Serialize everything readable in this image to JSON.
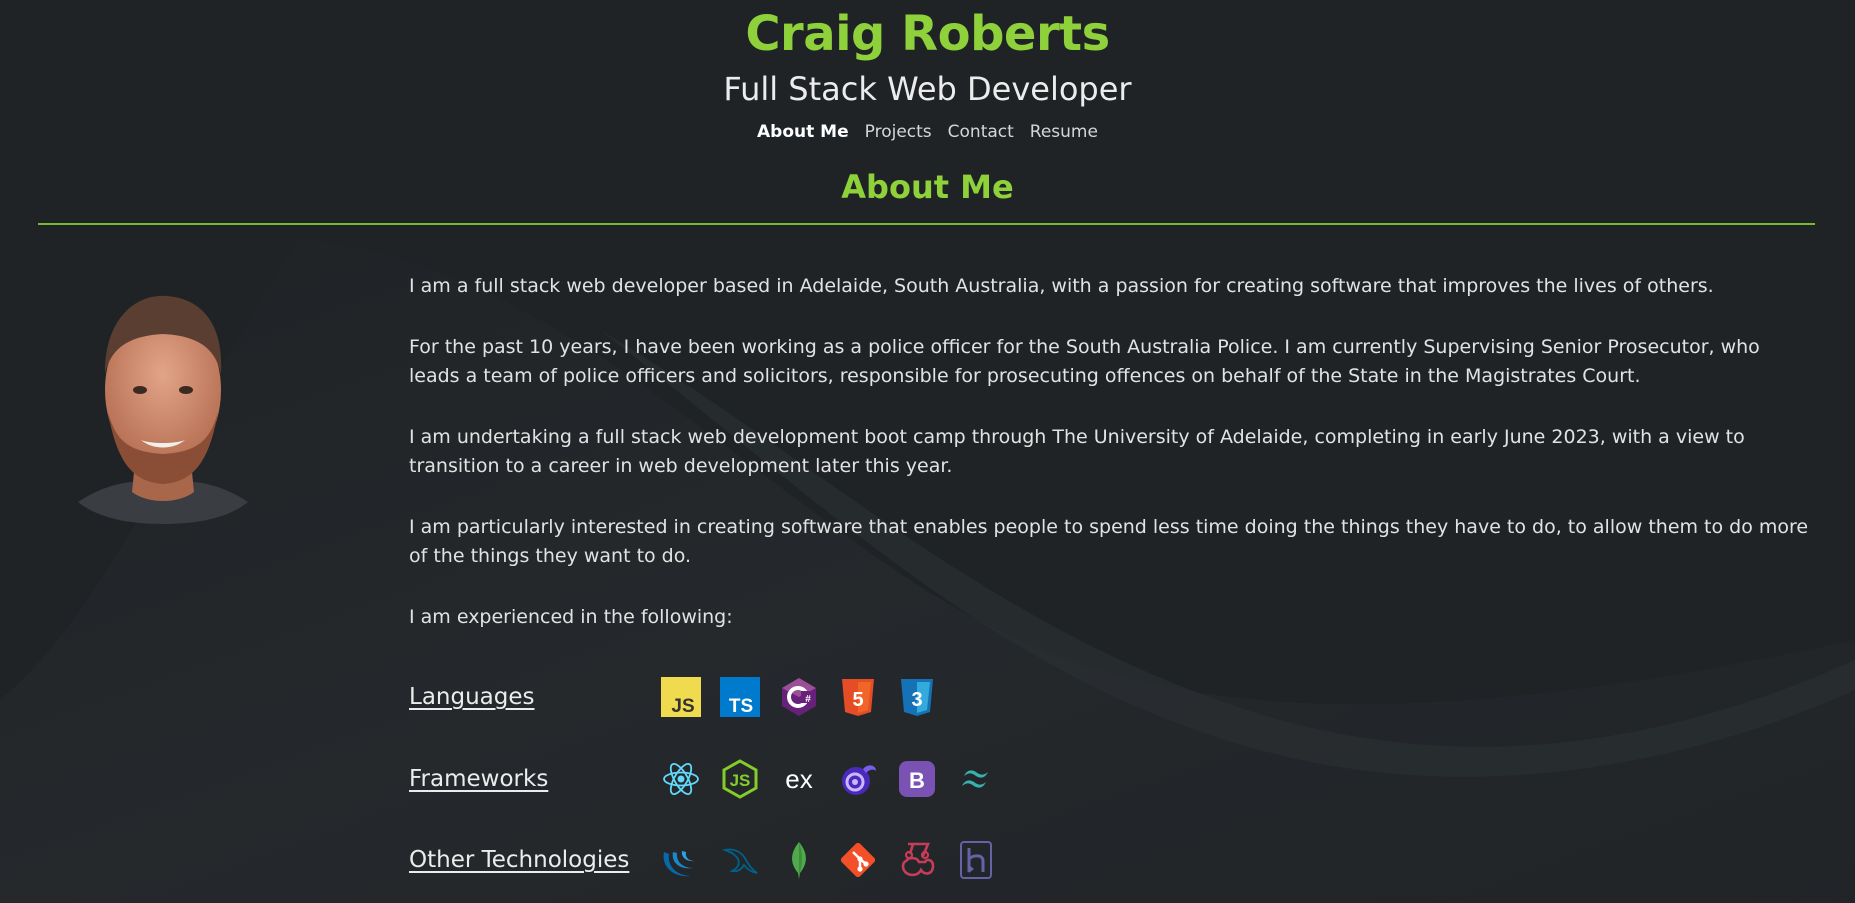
{
  "header": {
    "name": "Craig Roberts",
    "role": "Full Stack Web Developer"
  },
  "nav": {
    "items": [
      {
        "label": "About Me",
        "active": true
      },
      {
        "label": "Projects",
        "active": false
      },
      {
        "label": "Contact",
        "active": false
      },
      {
        "label": "Resume",
        "active": false
      }
    ]
  },
  "section": {
    "title": "About Me"
  },
  "about": {
    "paragraphs": [
      "I am a full stack web developer based in Adelaide, South Australia, with a passion for creating software that improves the lives of others.",
      "For the past 10 years, I have been working as a police officer for the South Australia Police. I am currently Supervising Senior Prosecutor, who leads a team of police officers and solicitors, responsible for prosecuting offences on behalf of the State in the Magistrates Court.",
      "I am undertaking a full stack web development boot camp through The University of Adelaide, completing in early June 2023, with a view to transition to a career in web development later this year.",
      "I am particularly interested in creating software that enables people to spend less time doing the things they have to do, to allow them to do more of the things they want to do.",
      "I am experienced in the following:"
    ]
  },
  "skills": {
    "languages": {
      "label": "Languages",
      "icons": [
        "javascript-icon",
        "typescript-icon",
        "csharp-icon",
        "html5-icon",
        "css3-icon"
      ]
    },
    "frameworks": {
      "label": "Frameworks",
      "icons": [
        "react-icon",
        "nodejs-icon",
        "express-icon",
        "blazor-icon",
        "bootstrap-icon",
        "tailwind-icon"
      ]
    },
    "other": {
      "label": "Other Technologies",
      "icons": [
        "jquery-icon",
        "mysql-icon",
        "mongodb-icon",
        "git-icon",
        "jest-icon",
        "heroku-icon"
      ]
    }
  },
  "colors": {
    "accent": "#8fd13a",
    "background": "#1f2326",
    "text": "#e4e4e4"
  }
}
